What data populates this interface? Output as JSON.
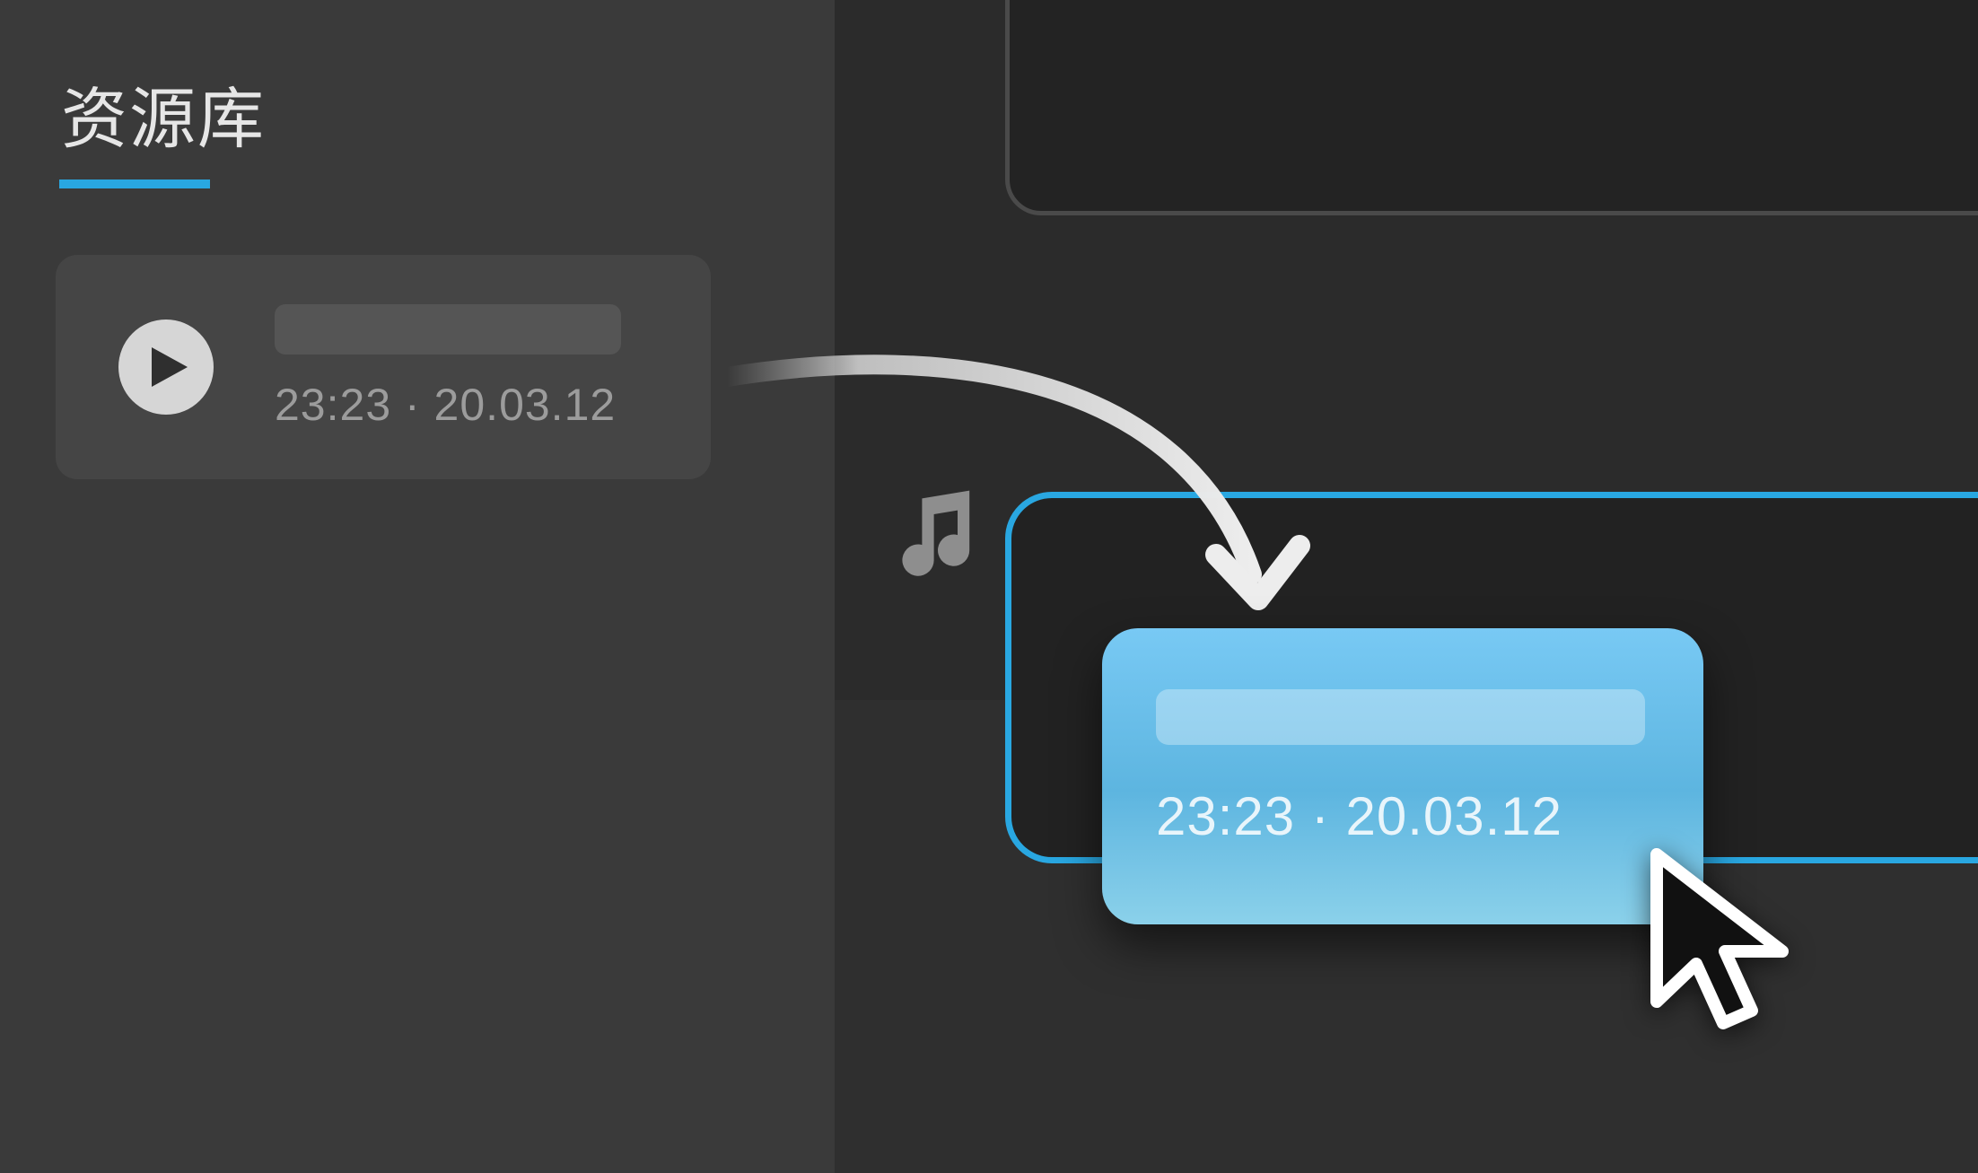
{
  "sidebar": {
    "title": "资源库",
    "accent_color": "#29a7e1"
  },
  "library_item": {
    "time": "23:23",
    "date": "20.03.12",
    "meta": "23:23 · 20.03.12",
    "icon": "play-icon"
  },
  "track": {
    "icon": "music-note-icon"
  },
  "dragged_clip": {
    "time": "23:23",
    "date": "20.03.12",
    "meta": "23:23 · 20.03.12"
  }
}
